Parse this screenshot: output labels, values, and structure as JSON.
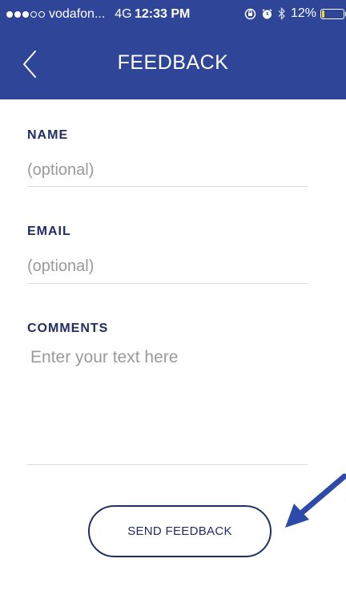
{
  "status_bar": {
    "carrier": "vodafon...",
    "network": "4G",
    "time": "12:33 PM",
    "battery": "12%",
    "battery_level": 0.12,
    "signal_bars_filled": 3,
    "signal_bars_total": 5,
    "icons": [
      "orientation-lock-icon",
      "alarm-icon",
      "bluetooth-icon"
    ]
  },
  "header": {
    "title": "FEEDBACK",
    "back_icon": "chevron-left-icon"
  },
  "form": {
    "name": {
      "label": "NAME",
      "placeholder": "(optional)"
    },
    "email": {
      "label": "EMAIL",
      "placeholder": "(optional)"
    },
    "comments": {
      "label": "COMMENTS",
      "placeholder": "Enter your text here"
    },
    "submit_label": "SEND FEEDBACK"
  },
  "colors": {
    "brand_blue": "#2f4598",
    "label_navy": "#1f2e63",
    "annotation_arrow": "#2e4aa8",
    "battery_yellow": "#f7d330"
  }
}
